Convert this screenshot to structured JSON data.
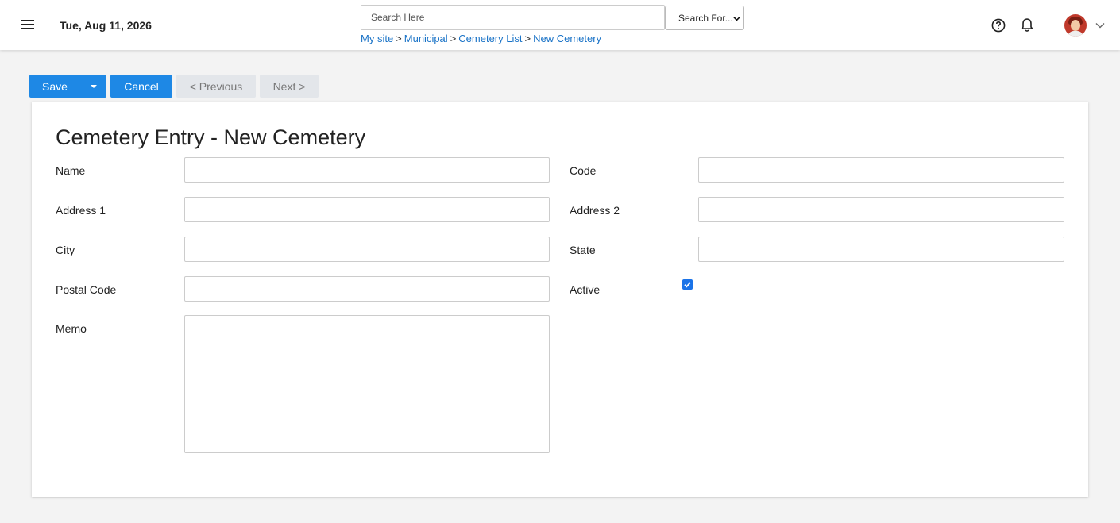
{
  "header": {
    "date": "Tue, Aug 11, 2026",
    "search_placeholder": "Search Here",
    "search_for": "Search For...",
    "breadcrumb": [
      "My site",
      "Municipal",
      "Cemetery List",
      "New Cemetery"
    ],
    "breadcrumb_sep": ">"
  },
  "toolbar": {
    "save": "Save",
    "cancel": "Cancel",
    "previous": "< Previous",
    "next": "Next >"
  },
  "form": {
    "title": "Cemetery Entry - New Cemetery",
    "fields": {
      "name": {
        "label": "Name",
        "value": ""
      },
      "code": {
        "label": "Code",
        "value": ""
      },
      "address1": {
        "label": "Address 1",
        "value": ""
      },
      "address2": {
        "label": "Address 2",
        "value": ""
      },
      "city": {
        "label": "City",
        "value": ""
      },
      "state": {
        "label": "State",
        "value": ""
      },
      "postal_code": {
        "label": "Postal Code",
        "value": ""
      },
      "active": {
        "label": "Active",
        "checked": true
      },
      "memo": {
        "label": "Memo",
        "value": ""
      }
    }
  },
  "colors": {
    "primary": "#1e88e5",
    "link": "#1a73c7",
    "disabled": "#e3e6ea"
  }
}
